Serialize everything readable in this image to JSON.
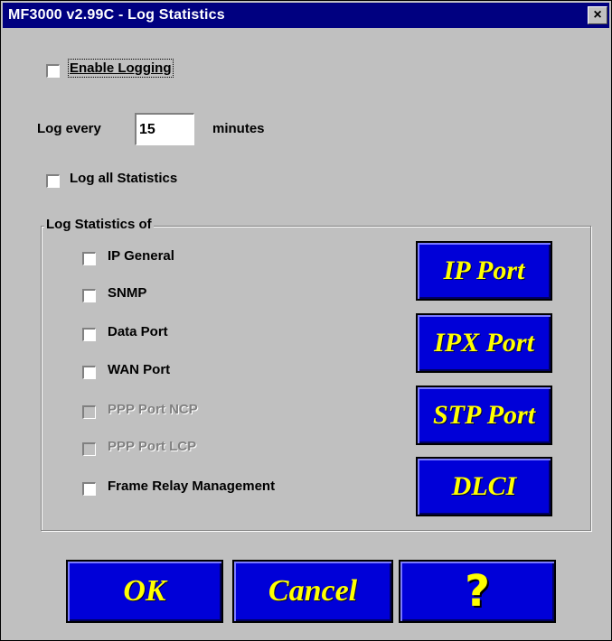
{
  "window": {
    "title": "MF3000 v2.99C -  Log Statistics",
    "close_glyph": "×"
  },
  "options": {
    "enable_logging": {
      "label": "Enable Logging",
      "checked": false
    },
    "log_every": {
      "prefix": "Log every",
      "value": "15",
      "suffix": "minutes"
    },
    "log_all_statistics": {
      "label": "Log all Statistics",
      "checked": false
    }
  },
  "group": {
    "caption": "Log Statistics of",
    "items": [
      {
        "label": "IP General",
        "checked": false,
        "enabled": true
      },
      {
        "label": "SNMP",
        "checked": false,
        "enabled": true
      },
      {
        "label": "Data Port",
        "checked": false,
        "enabled": true
      },
      {
        "label": "WAN Port",
        "checked": false,
        "enabled": true
      },
      {
        "label": "PPP Port NCP",
        "checked": false,
        "enabled": false
      },
      {
        "label": "PPP Port LCP",
        "checked": false,
        "enabled": false
      },
      {
        "label": "Frame Relay Management",
        "checked": false,
        "enabled": true
      }
    ],
    "buttons": [
      {
        "label": "IP Port"
      },
      {
        "label": "IPX Port"
      },
      {
        "label": "STP Port"
      },
      {
        "label": "DLCI"
      }
    ]
  },
  "footer": {
    "ok_label": "OK",
    "cancel_label": "Cancel",
    "help_label": "?"
  },
  "colors": {
    "title_bar": "#000080",
    "dialog_face": "#c0c0c0",
    "button_face": "#0000d8",
    "button_text": "#ffff00"
  }
}
